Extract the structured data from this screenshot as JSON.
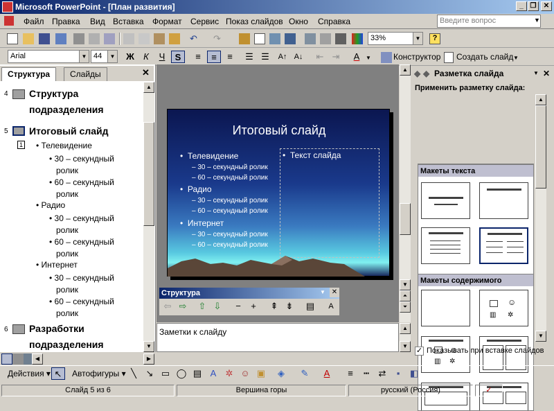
{
  "window": {
    "title": "Microsoft PowerPoint - [План развития]"
  },
  "menu": {
    "items": [
      "Файл",
      "Правка",
      "Вид",
      "Вставка",
      "Формат",
      "Сервис",
      "Показ слайдов",
      "Окно",
      "Справка"
    ],
    "help_placeholder": "Введите вопрос"
  },
  "toolbar": {
    "zoom": "33%"
  },
  "format_toolbar": {
    "font": "Arial",
    "size": "44",
    "bold": "Ж",
    "italic": "К",
    "underline": "Ч",
    "shadow": "S",
    "designer": "Конструктор",
    "new_slide": "Создать слайд"
  },
  "outline_pane": {
    "tabs": [
      "Структура",
      "Слайды"
    ],
    "entries": [
      {
        "num": "4",
        "title_lines": [
          "Структура",
          "подразделения"
        ]
      },
      {
        "num": "5",
        "title": "Итоговый слайд",
        "bullets": [
          {
            "text": "Телевидение",
            "subs": [
              "30 – секундный ролик",
              "60 – секундный ролик"
            ]
          },
          {
            "text": "Радио",
            "subs": [
              "30 – секундный ролик",
              "60 – секундный ролик"
            ]
          },
          {
            "text": "Интернет",
            "subs": [
              "30 – секундный ролик",
              "60 – секундный ролик"
            ]
          }
        ]
      },
      {
        "num": "6",
        "title_lines": [
          "Разработки",
          "подразделения"
        ]
      }
    ],
    "sub_line1": [
      "30 – секундный",
      "60 – секундный",
      "30 – секундный",
      "60 – секундный",
      "30 – секундный",
      "60 – секундный"
    ],
    "sub_line2": "ролик",
    "marker": "1"
  },
  "slide": {
    "title": "Итоговый слайд",
    "bullets": [
      {
        "text": "Телевидение",
        "subs": [
          "– 30 – секундный ролик",
          "– 60 – секундный ролик"
        ]
      },
      {
        "text": "Радио",
        "subs": [
          "– 30 – секундный ролик",
          "– 60 – секундный ролик"
        ]
      },
      {
        "text": "Интернет",
        "subs": [
          "– 30 – секундный ролик",
          "– 60 – секундный ролик"
        ]
      }
    ],
    "placeholder": "Текст слайда"
  },
  "structure_toolbar": {
    "title": "Структура"
  },
  "notes": {
    "placeholder": "Заметки к слайду"
  },
  "task_pane": {
    "title": "Разметка слайда",
    "apply_label": "Применить разметку слайда:",
    "section_text": "Макеты текста",
    "section_content": "Макеты содержимого",
    "show_on_insert": "Показывать при вставке слайдов"
  },
  "drawing_toolbar": {
    "actions": "Действия",
    "autoshapes": "Автофигуры"
  },
  "status_bar": {
    "slide": "Слайд 5 из 6",
    "design": "Вершина горы",
    "language": "русский (Россия)"
  },
  "colors": {
    "title_bar": "#0a246a",
    "slide_bg": "#1a3a8c",
    "section": "#bfbfd0"
  }
}
